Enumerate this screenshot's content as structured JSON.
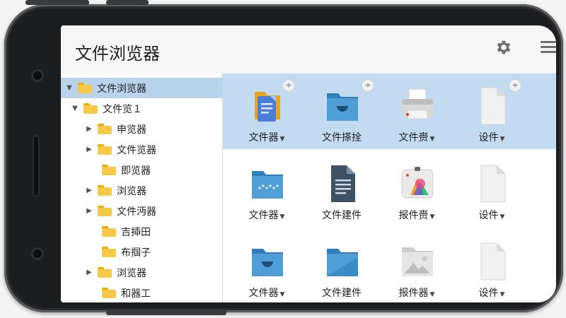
{
  "app": {
    "title": "文件浏览器"
  },
  "tree": [
    {
      "label": "文件浏览器",
      "expanded": true,
      "root": true
    },
    {
      "label": "文件览１",
      "expanded": true
    },
    {
      "label": "申览器"
    },
    {
      "label": "文件览器"
    },
    {
      "label": "即览器"
    },
    {
      "label": "浏览器"
    },
    {
      "label": "文件沔器"
    },
    {
      "label": "吉揷田"
    },
    {
      "label": "布掴子"
    },
    {
      "label": "浏览器"
    },
    {
      "label": "和器工"
    }
  ],
  "grid": [
    {
      "label": "文件器",
      "icon": "docs-folder-icon",
      "dropdown": true
    },
    {
      "label": "文件搽拴",
      "icon": "smile-folder-icon",
      "dropdown": false
    },
    {
      "label": "文件赍",
      "icon": "printer-icon",
      "dropdown": true
    },
    {
      "label": "设件",
      "icon": "blank-file-icon",
      "dropdown": true
    },
    {
      "label": "文件器",
      "icon": "dots-folder-icon",
      "dropdown": true
    },
    {
      "label": "文件建件",
      "icon": "text-file-icon",
      "dropdown": false
    },
    {
      "label": "报件赍",
      "icon": "photos-icon",
      "dropdown": true
    },
    {
      "label": "设件",
      "icon": "blank-file-icon",
      "dropdown": true
    },
    {
      "label": "文件器",
      "icon": "smile-folder-icon",
      "dropdown": true
    },
    {
      "label": "文件建件",
      "icon": "folder-icon",
      "dropdown": false
    },
    {
      "label": "报件器",
      "icon": "image-file-icon",
      "dropdown": true
    },
    {
      "label": "设件",
      "icon": "blank-file-icon",
      "dropdown": true
    }
  ],
  "ui": {
    "plus_symbol": "÷",
    "dropdown_arrow": "▼"
  },
  "colors": {
    "selection": "#c3dbf1",
    "folder": "#f7c948",
    "folder_blue": "#4f9fd6"
  }
}
